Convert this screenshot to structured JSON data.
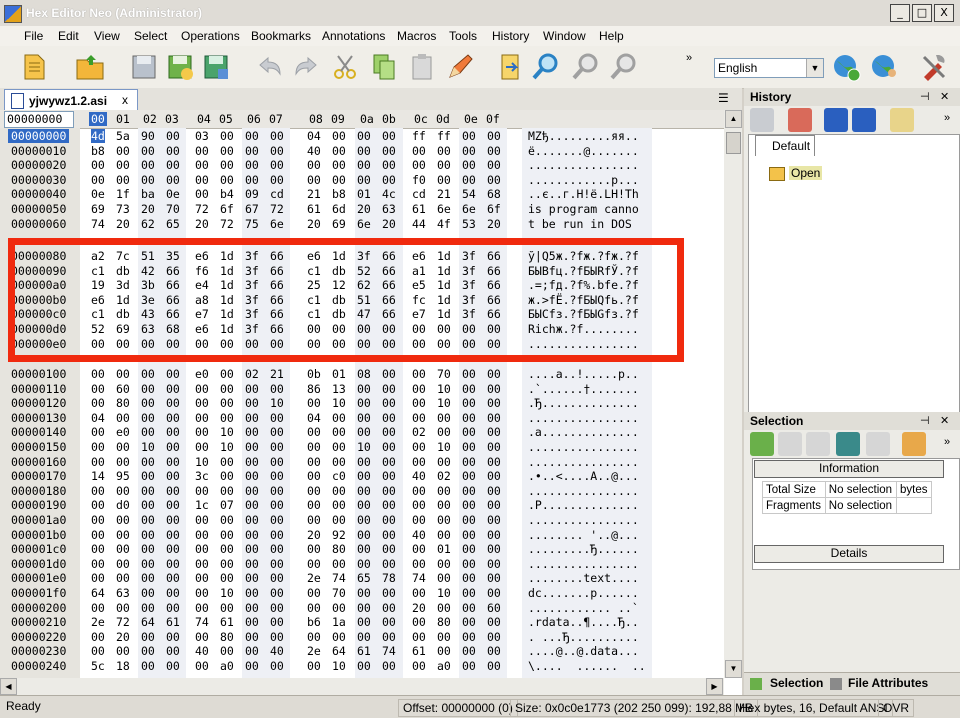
{
  "window": {
    "title": "Hex Editor Neo (Administrator)",
    "min": "_",
    "max": "□",
    "close": "X"
  },
  "menu": [
    "File",
    "Edit",
    "View",
    "Select",
    "Operations",
    "Bookmarks",
    "Annotations",
    "Macros",
    "Tools",
    "History",
    "Window",
    "Help"
  ],
  "language": {
    "selected": "English"
  },
  "doc": {
    "tab_name": "yjwywz1.2.asi",
    "tab_close": "x",
    "panel_menu": "☰"
  },
  "hex": {
    "offset_box": "00000000",
    "columns": [
      "00",
      "01",
      "02",
      "03",
      "04",
      "05",
      "06",
      "07",
      "08",
      "09",
      "0a",
      "0b",
      "0c",
      "0d",
      "0e",
      "0f"
    ],
    "rows": [
      {
        "addr": "00000000",
        "hex": [
          "4d",
          "5a",
          "90",
          "00",
          "03",
          "00",
          "00",
          "00",
          "04",
          "00",
          "00",
          "00",
          "ff",
          "ff",
          "00",
          "00"
        ],
        "ascii": "MZђ.........яя.."
      },
      {
        "addr": "00000010",
        "hex": [
          "b8",
          "00",
          "00",
          "00",
          "00",
          "00",
          "00",
          "00",
          "40",
          "00",
          "00",
          "00",
          "00",
          "00",
          "00",
          "00"
        ],
        "ascii": "ё.......@......."
      },
      {
        "addr": "00000020",
        "hex": [
          "00",
          "00",
          "00",
          "00",
          "00",
          "00",
          "00",
          "00",
          "00",
          "00",
          "00",
          "00",
          "00",
          "00",
          "00",
          "00"
        ],
        "ascii": "................"
      },
      {
        "addr": "00000030",
        "hex": [
          "00",
          "00",
          "00",
          "00",
          "00",
          "00",
          "00",
          "00",
          "00",
          "00",
          "00",
          "00",
          "f0",
          "00",
          "00",
          "00"
        ],
        "ascii": "............р..."
      },
      {
        "addr": "00000040",
        "hex": [
          "0e",
          "1f",
          "ba",
          "0e",
          "00",
          "b4",
          "09",
          "cd",
          "21",
          "b8",
          "01",
          "4c",
          "cd",
          "21",
          "54",
          "68"
        ],
        "ascii": "..є..г.Н!ё.LН!Th"
      },
      {
        "addr": "00000050",
        "hex": [
          "69",
          "73",
          "20",
          "70",
          "72",
          "6f",
          "67",
          "72",
          "61",
          "6d",
          "20",
          "63",
          "61",
          "6e",
          "6e",
          "6f"
        ],
        "ascii": "is program canno"
      },
      {
        "addr": "00000060",
        "hex": [
          "74",
          "20",
          "62",
          "65",
          "20",
          "72",
          "75",
          "6e",
          "20",
          "69",
          "6e",
          "20",
          "44",
          "4f",
          "53",
          "20"
        ],
        "ascii": "t be run in DOS "
      },
      {
        "addr": "00000080",
        "hex": [
          "a2",
          "7c",
          "51",
          "35",
          "e6",
          "1d",
          "3f",
          "66",
          "e6",
          "1d",
          "3f",
          "66",
          "e6",
          "1d",
          "3f",
          "66"
        ],
        "ascii": "ў|Q5ж.?fж.?fж.?f"
      },
      {
        "addr": "00000090",
        "hex": [
          "c1",
          "db",
          "42",
          "66",
          "f6",
          "1d",
          "3f",
          "66",
          "c1",
          "db",
          "52",
          "66",
          "a1",
          "1d",
          "3f",
          "66"
        ],
        "ascii": "БЫBfц.?fБЫRfЎ.?f"
      },
      {
        "addr": "000000a0",
        "hex": [
          "19",
          "3d",
          "3b",
          "66",
          "e4",
          "1d",
          "3f",
          "66",
          "25",
          "12",
          "62",
          "66",
          "e5",
          "1d",
          "3f",
          "66"
        ],
        "ascii": ".=;fд.?f%.bfе.?f"
      },
      {
        "addr": "000000b0",
        "hex": [
          "e6",
          "1d",
          "3e",
          "66",
          "a8",
          "1d",
          "3f",
          "66",
          "c1",
          "db",
          "51",
          "66",
          "fc",
          "1d",
          "3f",
          "66"
        ],
        "ascii": "ж.>fЁ.?fБЫQfь.?f"
      },
      {
        "addr": "000000c0",
        "hex": [
          "c1",
          "db",
          "43",
          "66",
          "e7",
          "1d",
          "3f",
          "66",
          "c1",
          "db",
          "47",
          "66",
          "e7",
          "1d",
          "3f",
          "66"
        ],
        "ascii": "БЫCfз.?fБЫGfз.?f"
      },
      {
        "addr": "000000d0",
        "hex": [
          "52",
          "69",
          "63",
          "68",
          "e6",
          "1d",
          "3f",
          "66",
          "00",
          "00",
          "00",
          "00",
          "00",
          "00",
          "00",
          "00"
        ],
        "ascii": "Richж.?f........"
      },
      {
        "addr": "000000e0",
        "hex": [
          "00",
          "00",
          "00",
          "00",
          "00",
          "00",
          "00",
          "00",
          "00",
          "00",
          "00",
          "00",
          "00",
          "00",
          "00",
          "00"
        ],
        "ascii": "................"
      },
      {
        "addr": "00000100",
        "hex": [
          "00",
          "00",
          "00",
          "00",
          "e0",
          "00",
          "02",
          "21",
          "0b",
          "01",
          "08",
          "00",
          "00",
          "70",
          "00",
          "00"
        ],
        "ascii": "....а..!.....р.."
      },
      {
        "addr": "00000110",
        "hex": [
          "00",
          "60",
          "00",
          "00",
          "00",
          "00",
          "00",
          "00",
          "86",
          "13",
          "00",
          "00",
          "00",
          "10",
          "00",
          "00"
        ],
        "ascii": ".`......†......."
      },
      {
        "addr": "00000120",
        "hex": [
          "00",
          "80",
          "00",
          "00",
          "00",
          "00",
          "00",
          "10",
          "00",
          "10",
          "00",
          "00",
          "00",
          "10",
          "00",
          "00"
        ],
        "ascii": ".Ђ.............."
      },
      {
        "addr": "00000130",
        "hex": [
          "04",
          "00",
          "00",
          "00",
          "00",
          "00",
          "00",
          "00",
          "04",
          "00",
          "00",
          "00",
          "00",
          "00",
          "00",
          "00"
        ],
        "ascii": "................"
      },
      {
        "addr": "00000140",
        "hex": [
          "00",
          "e0",
          "00",
          "00",
          "00",
          "10",
          "00",
          "00",
          "00",
          "00",
          "00",
          "00",
          "02",
          "00",
          "00",
          "00"
        ],
        "ascii": ".а.............."
      },
      {
        "addr": "00000150",
        "hex": [
          "00",
          "00",
          "10",
          "00",
          "00",
          "10",
          "00",
          "00",
          "00",
          "00",
          "10",
          "00",
          "00",
          "10",
          "00",
          "00"
        ],
        "ascii": "................"
      },
      {
        "addr": "00000160",
        "hex": [
          "00",
          "00",
          "00",
          "00",
          "10",
          "00",
          "00",
          "00",
          "00",
          "00",
          "00",
          "00",
          "00",
          "00",
          "00",
          "00"
        ],
        "ascii": "................"
      },
      {
        "addr": "00000170",
        "hex": [
          "14",
          "95",
          "00",
          "00",
          "3c",
          "00",
          "00",
          "00",
          "00",
          "c0",
          "00",
          "00",
          "40",
          "02",
          "00",
          "00"
        ],
        "ascii": ".•..<....А..@..."
      },
      {
        "addr": "00000180",
        "hex": [
          "00",
          "00",
          "00",
          "00",
          "00",
          "00",
          "00",
          "00",
          "00",
          "00",
          "00",
          "00",
          "00",
          "00",
          "00",
          "00"
        ],
        "ascii": "................"
      },
      {
        "addr": "00000190",
        "hex": [
          "00",
          "d0",
          "00",
          "00",
          "1c",
          "07",
          "00",
          "00",
          "00",
          "00",
          "00",
          "00",
          "00",
          "00",
          "00",
          "00"
        ],
        "ascii": ".Р.............."
      },
      {
        "addr": "000001a0",
        "hex": [
          "00",
          "00",
          "00",
          "00",
          "00",
          "00",
          "00",
          "00",
          "00",
          "00",
          "00",
          "00",
          "00",
          "00",
          "00",
          "00"
        ],
        "ascii": "................"
      },
      {
        "addr": "000001b0",
        "hex": [
          "00",
          "00",
          "00",
          "00",
          "00",
          "00",
          "00",
          "00",
          "20",
          "92",
          "00",
          "00",
          "40",
          "00",
          "00",
          "00"
        ],
        "ascii": "........ '..@..."
      },
      {
        "addr": "000001c0",
        "hex": [
          "00",
          "00",
          "00",
          "00",
          "00",
          "00",
          "00",
          "00",
          "00",
          "80",
          "00",
          "00",
          "00",
          "01",
          "00",
          "00"
        ],
        "ascii": ".........Ђ......"
      },
      {
        "addr": "000001d0",
        "hex": [
          "00",
          "00",
          "00",
          "00",
          "00",
          "00",
          "00",
          "00",
          "00",
          "00",
          "00",
          "00",
          "00",
          "00",
          "00",
          "00"
        ],
        "ascii": "................"
      },
      {
        "addr": "000001e0",
        "hex": [
          "00",
          "00",
          "00",
          "00",
          "00",
          "00",
          "00",
          "00",
          "2e",
          "74",
          "65",
          "78",
          "74",
          "00",
          "00",
          "00"
        ],
        "ascii": "........text...."
      },
      {
        "addr": "000001f0",
        "hex": [
          "64",
          "63",
          "00",
          "00",
          "00",
          "10",
          "00",
          "00",
          "00",
          "70",
          "00",
          "00",
          "00",
          "10",
          "00",
          "00"
        ],
        "ascii": "dc.......р......"
      },
      {
        "addr": "00000200",
        "hex": [
          "00",
          "00",
          "00",
          "00",
          "00",
          "00",
          "00",
          "00",
          "00",
          "00",
          "00",
          "00",
          "20",
          "00",
          "00",
          "60"
        ],
        "ascii": "............ ..`"
      },
      {
        "addr": "00000210",
        "hex": [
          "2e",
          "72",
          "64",
          "61",
          "74",
          "61",
          "00",
          "00",
          "b6",
          "1a",
          "00",
          "00",
          "00",
          "80",
          "00",
          "00"
        ],
        "ascii": ".rdata..¶....Ђ.."
      },
      {
        "addr": "00000220",
        "hex": [
          "00",
          "20",
          "00",
          "00",
          "00",
          "80",
          "00",
          "00",
          "00",
          "00",
          "00",
          "00",
          "00",
          "00",
          "00",
          "00"
        ],
        "ascii": ". ...Ђ.........."
      },
      {
        "addr": "00000230",
        "hex": [
          "00",
          "00",
          "00",
          "00",
          "40",
          "00",
          "00",
          "40",
          "2e",
          "64",
          "61",
          "74",
          "61",
          "00",
          "00",
          "00"
        ],
        "ascii": "....@..@.data..."
      },
      {
        "addr": "00000240",
        "hex": [
          "5c",
          "18",
          "00",
          "00",
          "00",
          "a0",
          "00",
          "00",
          "00",
          "10",
          "00",
          "00",
          "00",
          "a0",
          "00",
          "00"
        ],
        "ascii": "\\....  ......  .."
      }
    ]
  },
  "history_panel": {
    "title": "History",
    "pin": "⊣",
    "close": "✕",
    "tab": "Default",
    "item": "Open"
  },
  "selection_panel": {
    "title": "Selection",
    "pin": "⊣",
    "close": "✕",
    "info_label": "Information",
    "rows": [
      [
        "Total Size",
        "No selection",
        "bytes"
      ],
      [
        "Fragments",
        "No selection",
        ""
      ]
    ],
    "details_label": "Details"
  },
  "bottom_tabs": [
    "Selection",
    "File Attributes"
  ],
  "status": {
    "ready": "Ready",
    "offset": "Offset: 00000000 (0)",
    "size": "Size: 0x0c0e1773 (202 250 099): 192,88 MB",
    "mode": "Hex bytes, 16, Default ANSI",
    "ovr": "OVR"
  },
  "colors": {
    "accent": "#316ac5",
    "highlight_frame": "#f02a0e"
  }
}
